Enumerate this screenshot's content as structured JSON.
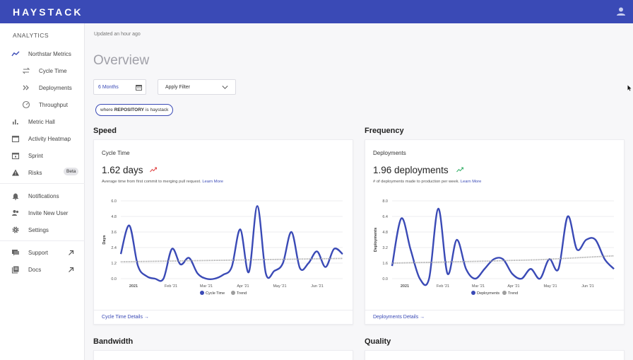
{
  "app": {
    "logo": "HAYSTACK"
  },
  "sidebar": {
    "section": "ANALYTICS",
    "items": [
      {
        "label": "Northstar Metrics",
        "icon": "trending-line-icon"
      },
      {
        "label": "Cycle Time",
        "icon": "cycle-icon"
      },
      {
        "label": "Deployments",
        "icon": "double-chevron-icon"
      },
      {
        "label": "Throughput",
        "icon": "gauge-icon"
      },
      {
        "label": "Metric Hall",
        "icon": "bar-chart-icon"
      },
      {
        "label": "Activity Heatmap",
        "icon": "calendar-icon"
      },
      {
        "label": "Sprint",
        "icon": "calendar-check-icon"
      },
      {
        "label": "Risks",
        "icon": "warning-icon",
        "badge": "Beta"
      },
      {
        "label": "Notifications",
        "icon": "bell-icon"
      },
      {
        "label": "Invite New User",
        "icon": "add-user-icon"
      },
      {
        "label": "Settings",
        "icon": "gear-icon"
      },
      {
        "label": "Support",
        "icon": "chat-icon"
      },
      {
        "label": "Docs",
        "icon": "docs-icon"
      }
    ]
  },
  "header": {
    "updated": "Updated an hour ago",
    "title": "Overview",
    "period": "6 Months",
    "filter_label": "Apply Filter",
    "chip": {
      "prefix": "where",
      "key": "REPOSITORY",
      "middle": "is",
      "value": "haystack"
    }
  },
  "sections": {
    "speed": "Speed",
    "frequency": "Frequency",
    "bandwidth": "Bandwidth",
    "quality": "Quality"
  },
  "cards": {
    "cycle": {
      "title": "Cycle Time",
      "value": "1.62 days",
      "desc": "Average time from first commit to merging pull request.",
      "learn_more": "Learn More",
      "footer": "Cycle Time Details →"
    },
    "deploy": {
      "title": "Deployments",
      "value": "1.96 deployments",
      "desc": "# of deployments made to production per week.",
      "learn_more": "Learn More",
      "footer": "Deployments Details →"
    }
  },
  "colors": {
    "brand": "#3a4ab6",
    "trend": "#9e9e9e",
    "down": "#e24a4a",
    "up": "#3cb36e"
  },
  "chart_data": [
    {
      "type": "line",
      "ylabel": "Days",
      "yticks": [
        "0.0",
        "1.2",
        "2.4",
        "3.6",
        "4.8",
        "6.0"
      ],
      "ylim": [
        0,
        6
      ],
      "xticks": [
        "2021",
        "Feb '21",
        "Mar '21",
        "Apr '21",
        "May '21",
        "Jun '21"
      ],
      "legend": "bottom",
      "series": [
        {
          "name": "Cycle Time",
          "values": [
            1.9,
            4.1,
            1.0,
            0.2,
            0.0,
            0.0,
            2.3,
            1.1,
            1.6,
            0.4,
            0.0,
            0.0,
            0.3,
            0.9,
            3.8,
            0.5,
            5.6,
            0.4,
            0.6,
            1.2,
            3.6,
            0.8,
            1.2,
            2.1,
            0.9,
            2.3,
            1.9
          ]
        },
        {
          "name": "Trend",
          "values": [
            1.3,
            1.31,
            1.32,
            1.33,
            1.34,
            1.35,
            1.36,
            1.37,
            1.38,
            1.39,
            1.4,
            1.41,
            1.42,
            1.43,
            1.44,
            1.45,
            1.46,
            1.47,
            1.48,
            1.49,
            1.5,
            1.51,
            1.52,
            1.53,
            1.54,
            1.55,
            1.56
          ]
        }
      ]
    },
    {
      "type": "line",
      "ylabel": "Deployments",
      "yticks": [
        "0.0",
        "1.6",
        "3.2",
        "4.8",
        "6.4",
        "8.0"
      ],
      "ylim": [
        0,
        8
      ],
      "xticks": [
        "2021",
        "Feb '21",
        "Mar '21",
        "Apr '21",
        "May '21",
        "Jun '21"
      ],
      "legend": "bottom",
      "series": [
        {
          "name": "Deployments",
          "values": [
            1.3,
            6.2,
            3.0,
            0.0,
            0.0,
            7.2,
            0.5,
            4.0,
            1.0,
            0.0,
            1.0,
            2.0,
            2.0,
            0.5,
            0.0,
            1.0,
            0.0,
            2.0,
            1.0,
            6.4,
            3.0,
            4.0,
            4.0,
            2.0,
            1.0
          ]
        },
        {
          "name": "Trend",
          "values": [
            1.6,
            1.62,
            1.64,
            1.66,
            1.68,
            1.7,
            1.72,
            1.74,
            1.76,
            1.78,
            1.8,
            1.82,
            1.85,
            1.88,
            1.9,
            1.92,
            1.95,
            2.0,
            2.05,
            2.1,
            2.15,
            2.2,
            2.25,
            2.3,
            2.35
          ]
        }
      ]
    }
  ]
}
